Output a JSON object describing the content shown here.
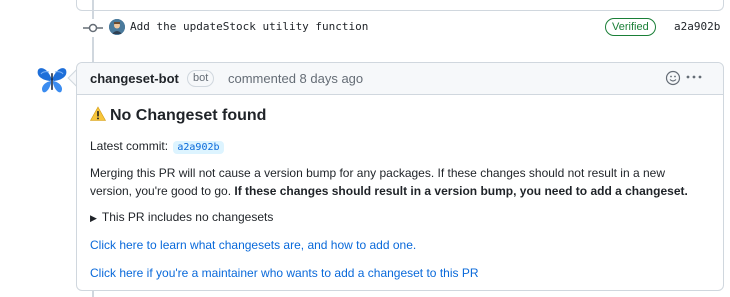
{
  "commit": {
    "message": "Add the updateStock utility function",
    "verified_label": "Verified",
    "sha": "a2a902b"
  },
  "comment": {
    "author": "changeset-bot",
    "bot_badge": "bot",
    "meta": "commented 8 days ago",
    "heading": "No Changeset found",
    "latest_label": "Latest commit:",
    "latest_sha": "a2a902b",
    "paragraph_normal": "Merging this PR will not cause a version bump for any packages. If these changes should not result in a new version, you're good to go.",
    "paragraph_bold": "If these changes should result in a version bump, you need to add a changeset.",
    "details_summary": "This PR includes no changesets",
    "link_learn": "Click here to learn what changesets are, and how to add one.",
    "link_maintainer": "Click here if you're a maintainer who wants to add a changeset to this PR"
  },
  "colors": {
    "link": "#0969da",
    "verified": "#1a7f37",
    "border": "#d0d7de",
    "header_bg": "#f6f8fa"
  },
  "icons": [
    "commit-icon",
    "butterfly-avatar",
    "smiley-icon",
    "kebab-icon",
    "warning-icon",
    "triangle-right-icon"
  ]
}
